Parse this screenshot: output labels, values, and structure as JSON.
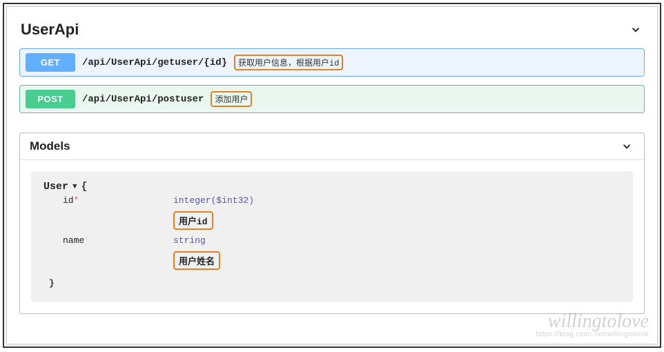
{
  "api_group": {
    "title": "UserApi",
    "endpoints": [
      {
        "method": "GET",
        "path": "/api/UserApi/getuser/{id}",
        "summary": "获取用户信息，根据用户id"
      },
      {
        "method": "POST",
        "path": "/api/UserApi/postuser",
        "summary": "添加用户"
      }
    ]
  },
  "models": {
    "title": "Models",
    "items": [
      {
        "name": "User",
        "brace_open": "{",
        "brace_close": "}",
        "properties": [
          {
            "name": "id",
            "required": true,
            "star": "*",
            "type": "integer($int32)",
            "description": "用户id"
          },
          {
            "name": "name",
            "required": false,
            "star": "",
            "type": "string",
            "description": "用户姓名"
          }
        ]
      }
    ]
  },
  "watermark": {
    "text": "willingtolove",
    "sub": "https://blog.csdn.net/willingtolove"
  },
  "colors": {
    "highlight_border": "#e67e22",
    "get_bg": "#ecf5fd",
    "get_border": "#69a9e8",
    "get_badge": "#61affe",
    "post_bg": "#eaf7f0",
    "post_border": "#57c292",
    "post_badge": "#49cc90"
  }
}
